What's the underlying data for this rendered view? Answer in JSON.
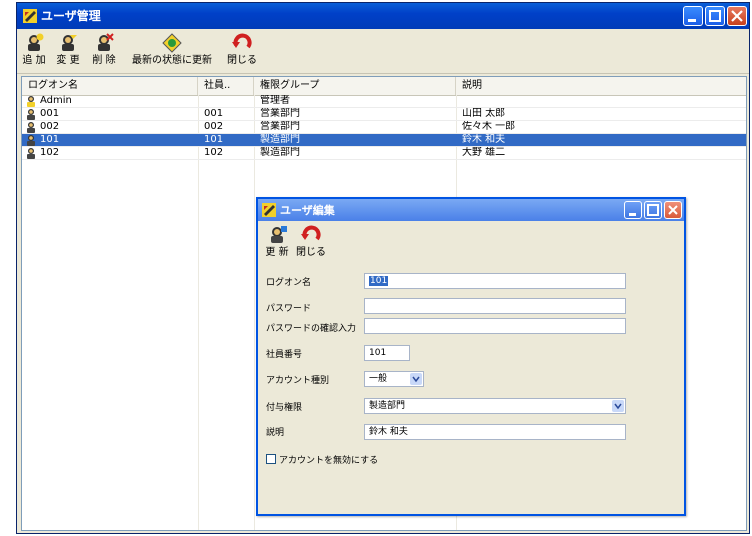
{
  "window": {
    "title": "ユーザ管理"
  },
  "toolbar": {
    "add": "追 加",
    "change": "変 更",
    "delete": "削 除",
    "refresh": "最新の状態に更新",
    "close": "閉じる"
  },
  "table": {
    "columns": [
      "ログオン名",
      "社員..",
      "権限グループ",
      "説明"
    ],
    "rows": [
      {
        "logon": "Admin",
        "emp": "",
        "group": "管理者",
        "desc": "",
        "icon": "admin-user-icon",
        "selected": false
      },
      {
        "logon": "001",
        "emp": "001",
        "group": "営業部門",
        "desc": "山田 太郎",
        "icon": "user-icon",
        "selected": false
      },
      {
        "logon": "002",
        "emp": "002",
        "group": "営業部門",
        "desc": "佐々木 一郎",
        "icon": "user-icon",
        "selected": false
      },
      {
        "logon": "101",
        "emp": "101",
        "group": "製造部門",
        "desc": "鈴木 和夫",
        "icon": "user-icon",
        "selected": true
      },
      {
        "logon": "102",
        "emp": "102",
        "group": "製造部門",
        "desc": "大野 雄二",
        "icon": "user-icon",
        "selected": false
      }
    ]
  },
  "dialog": {
    "title": "ユーザ編集",
    "toolbar": {
      "update": "更 新",
      "close": "閉じる"
    },
    "fields": {
      "logon_label": "ログオン名",
      "logon_value": "101",
      "password_label": "パスワード",
      "password_value": "",
      "password_confirm_label": "パスワードの確認入力",
      "password_confirm_value": "",
      "emp_no_label": "社員番号",
      "emp_no_value": "101",
      "account_type_label": "アカウント種別",
      "account_type_value": "一般",
      "group_label": "付与権限",
      "group_value": "製造部門",
      "desc_label": "説明",
      "desc_value": "鈴木 和夫",
      "disable_label": "アカウントを無効にする"
    }
  },
  "colors": {
    "selection": "#316ac5",
    "titlebar": "#0054e3",
    "face": "#ece9d8"
  }
}
